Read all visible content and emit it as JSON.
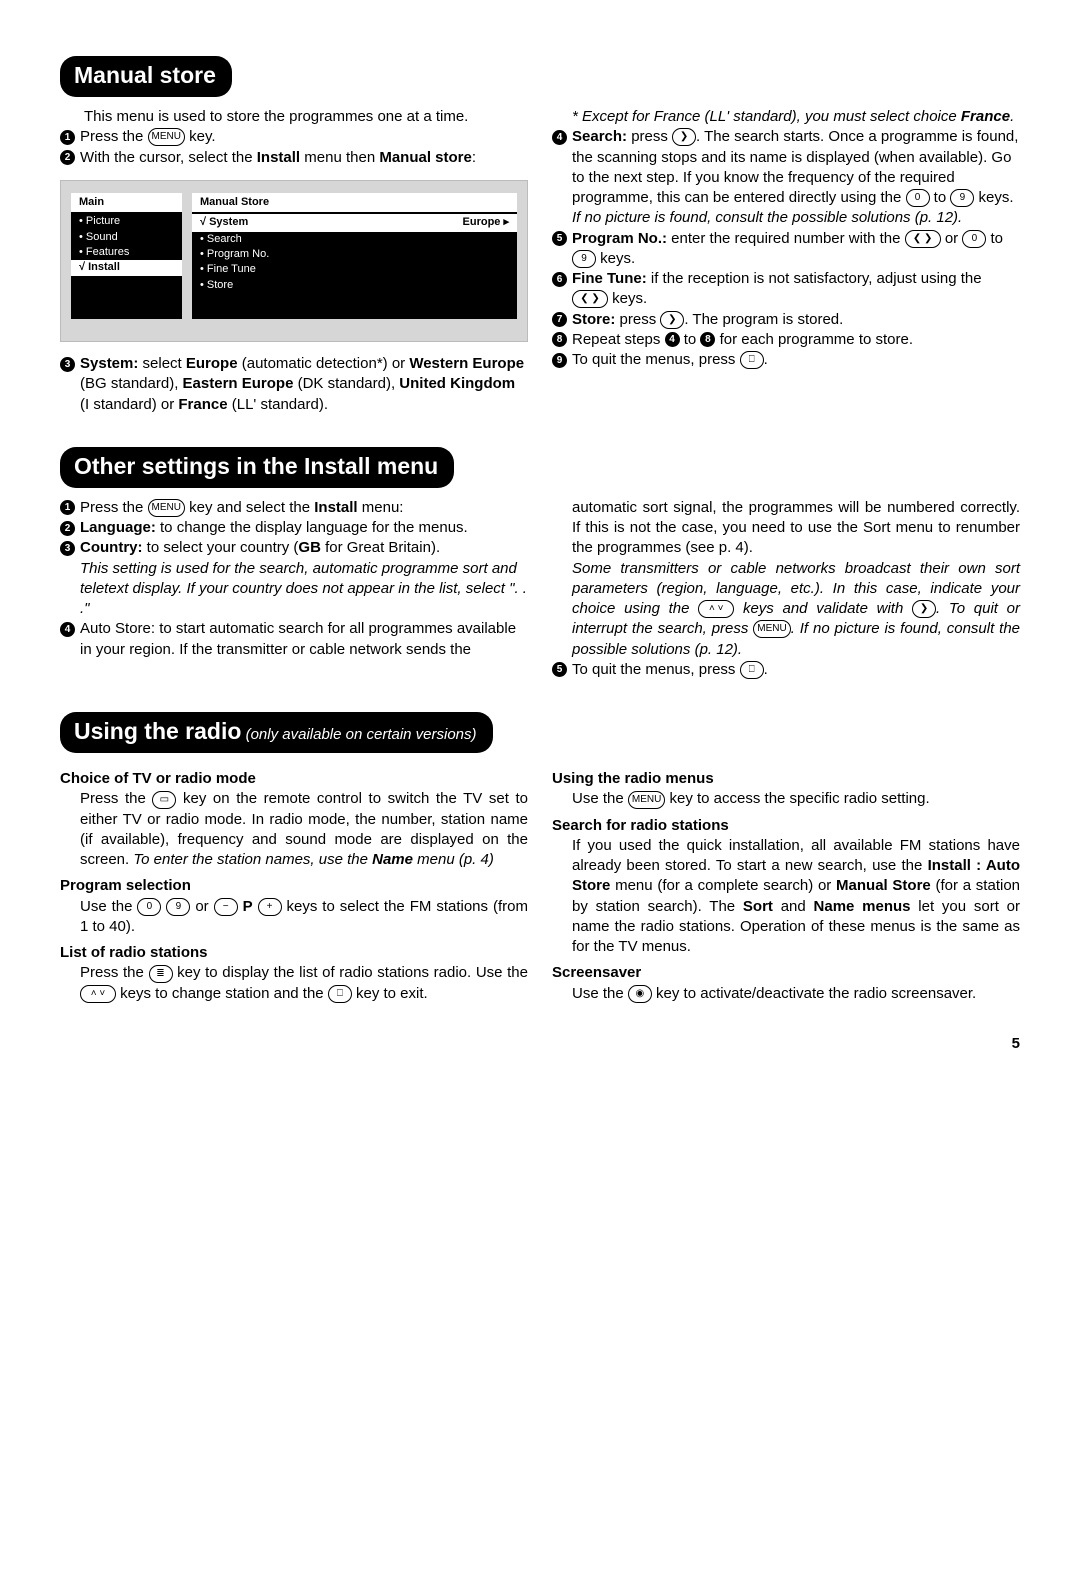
{
  "sections": {
    "s1": {
      "title": "Manual store",
      "intro": "This menu is used to store the programmes one at a time.",
      "step1": "Press the ",
      "step1b": " key.",
      "step2a": "With the cursor, select the ",
      "step2b": "Install",
      "step2c": " menu then ",
      "step2d": "Manual store",
      "step2e": ":",
      "menu": {
        "main_title": "Main",
        "main_items": [
          "• Picture",
          "• Sound",
          "• Features",
          "√ Install"
        ],
        "panel_title": "Manual Store",
        "sel_label": "√ System",
        "sel_value": "Europe ▸",
        "items": [
          "• Search",
          "• Program No.",
          "• Fine Tune",
          "• Store"
        ]
      },
      "step3a": "System:",
      "step3b": " select ",
      "step3c": "Europe",
      "step3d": " (automatic detection*) or ",
      "step3e": "Western Europe",
      "step3f": " (BG standard), ",
      "step3g": "Eastern Europe",
      "step3h": " (DK standard), ",
      "step3i": "United Kingdom",
      "step3j": " (I standard) or ",
      "step3k": "France",
      "step3l": " (LL' standard).",
      "note_a": "* Except for France (LL' standard), you must select choice ",
      "note_b": "France",
      "note_c": ".",
      "step4a": "Search:",
      "step4b": " press ",
      "step4c": ". The search starts. Once a programme is found, the scanning stops and its name is displayed (when available). Go to the next step. If you know the frequency of the required programme, this can be entered directly using the ",
      "step4d": " to ",
      "step4e": " keys.",
      "step4note": "If no picture is found, consult the possible solutions (p. 12).",
      "step5a": "Program No.:",
      "step5b": " enter the required number with the ",
      "step5c": " or ",
      "step5d": " to ",
      "step5e": " keys.",
      "step6a": "Fine Tune:",
      "step6b": " if the reception is not satisfactory, adjust using the ",
      "step6c": " keys.",
      "step7a": "Store:",
      "step7b": " press ",
      "step7c": ". The program is stored.",
      "step8a": "Repeat steps ",
      "step8b": " to ",
      "step8c": " for each programme to store.",
      "step9a": "To quit the menus, press ",
      "step9b": "."
    },
    "s2": {
      "title": "Other settings in the Install menu",
      "step1a": "Press the ",
      "step1b": " key and select the ",
      "step1c": "Install",
      "step1d": " menu:",
      "step2a": "Language:",
      "step2b": " to change the display language for the menus.",
      "step3a": "Country:",
      "step3b": " to select your country (",
      "step3c": "GB",
      "step3d": " for Great Britain).",
      "step3note": "This setting is used for the search, automatic programme sort and teletext display. If your country does not appear in the list, select \". . .\"",
      "step4": "Auto Store: to start automatic search for all programmes available in your region. If the transmitter or cable network sends the",
      "r1": "automatic sort signal, the programmes will be numbered correctly. If this is not the case, you need to use the Sort menu to renumber the programmes (see p. 4).",
      "rnote_a": "Some transmitters or cable networks broadcast their own sort parameters (region, language, etc.). In this case, indicate your choice using the ",
      "rnote_b": " keys and validate with ",
      "rnote_c": ". To quit or interrupt the search, press ",
      "rnote_d": ". If no picture is found, consult the possible solutions (p. 12).",
      "step5a": "To quit the menus, press ",
      "step5b": "."
    },
    "s3": {
      "title": "Using the radio",
      "sub": " (only available on certain versions)",
      "h1": "Choice of TV or radio mode",
      "p1a": "Press the ",
      "p1b": " key on the remote control to switch the TV set to either TV or radio mode. In radio mode, the number, station name (if available), frequency and sound mode are displayed on the screen. ",
      "p1note_a": "To enter the station names, use the ",
      "p1note_b": "Name",
      "p1note_c": " menu (p. 4)",
      "h2": "Program selection",
      "p2a": "Use the ",
      "p2b": " or ",
      "p2c": " keys to select the FM stations (from 1 to 40).",
      "h3": "List of radio stations",
      "p3a": "Press the ",
      "p3b": " key to display the list of radio stations radio. Use the ",
      "p3c": " keys to change station and the ",
      "p3d": " key to exit.",
      "h4": "Using the radio menus",
      "p4a": "Use the ",
      "p4b": " key to access the specific radio setting.",
      "h5": "Search for radio stations",
      "p5a": "If you used the quick installation, all available FM stations have already been stored. To start a new search, use the ",
      "p5b": "Install : Auto Store",
      "p5c": " menu (for a complete search) or ",
      "p5d": "Manual Store",
      "p5e": " (for a station by station search). The ",
      "p5f": "Sort",
      "p5g": " and ",
      "p5h": "Name menus",
      "p5i": " let you sort or name the radio stations. Operation of these menus is the same as for the TV menus.",
      "h6": "Screensaver",
      "p6a": "Use the ",
      "p6b": " key to activate/deactivate the radio screensaver."
    }
  },
  "keys": {
    "menu": "MENU",
    "right": "❯",
    "leftright": "❮ ❯",
    "updown": "˄ ˅",
    "zero": "0",
    "nine": "9",
    "minus": "−",
    "plus": "+",
    "p": "P",
    "list": "≣",
    "exit": "⎕",
    "radio": "◉",
    "tv": "▭"
  },
  "page": "5"
}
